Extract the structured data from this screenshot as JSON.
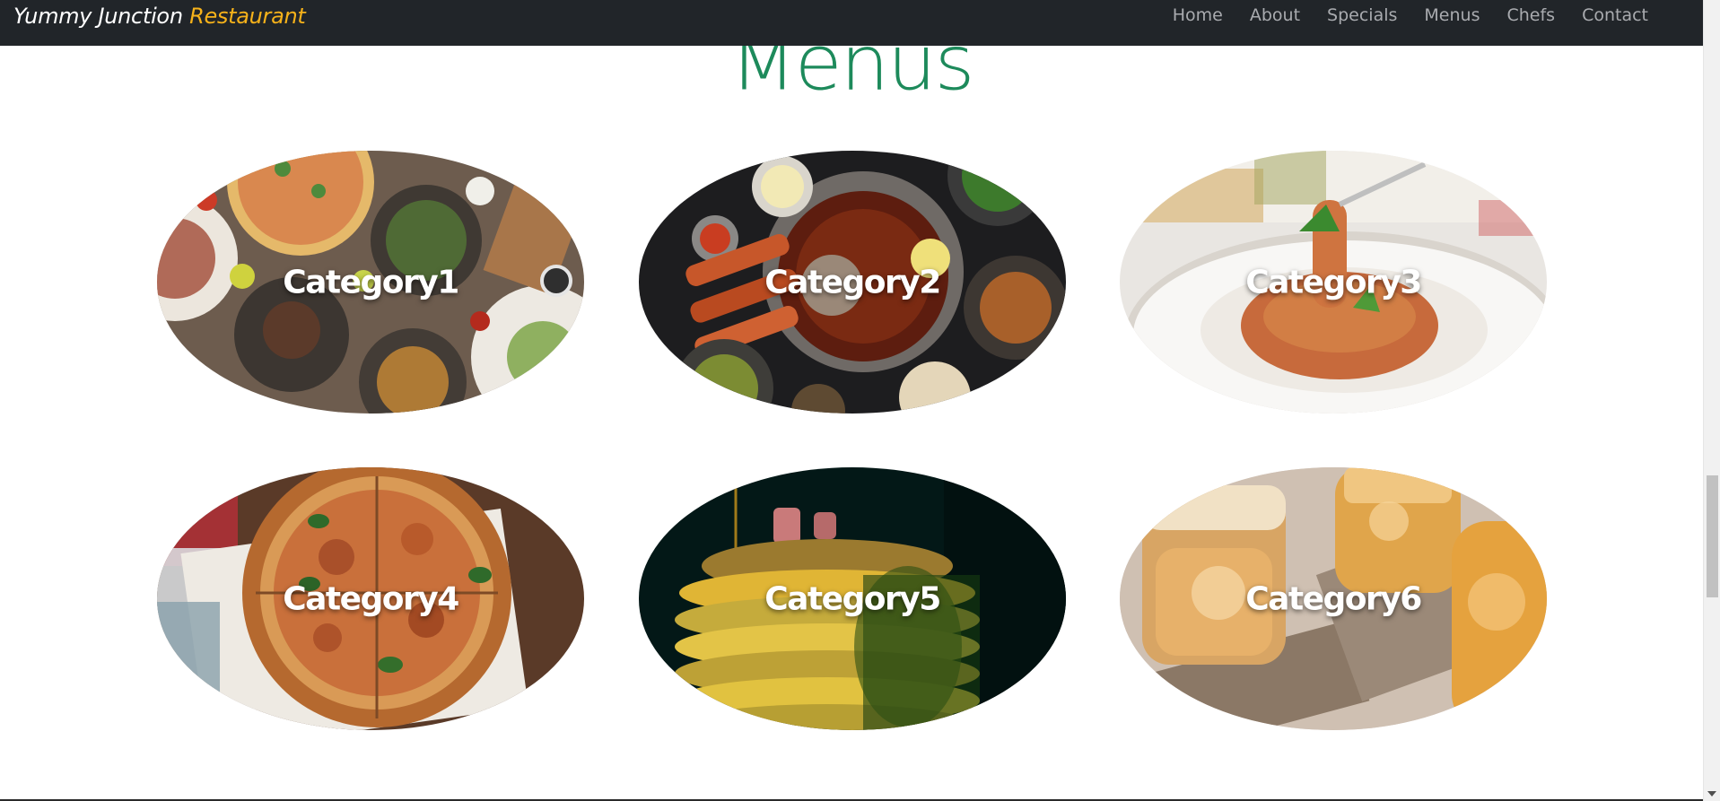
{
  "navbar": {
    "brand_main": "Yummy Junction",
    "brand_accent": "Restaurant",
    "links": [
      "Home",
      "About",
      "Specials",
      "Menus",
      "Chefs",
      "Contact"
    ]
  },
  "section": {
    "title": "Menus"
  },
  "categories": [
    {
      "label": "Category1",
      "image": "mixed-dishes-platter"
    },
    {
      "label": "Category2",
      "image": "asian-skewers-soup"
    },
    {
      "label": "Category3",
      "image": "spaghetti-plate"
    },
    {
      "label": "Category4",
      "image": "pizza"
    },
    {
      "label": "Category5",
      "image": "pancake-stack-syrup"
    },
    {
      "label": "Category6",
      "image": "iced-drinks"
    }
  ],
  "colors": {
    "navbar_bg": "#212529",
    "brand_accent": "#f6b21a",
    "nav_link": "#a9abaf",
    "title_green": "#1d8a5b"
  }
}
